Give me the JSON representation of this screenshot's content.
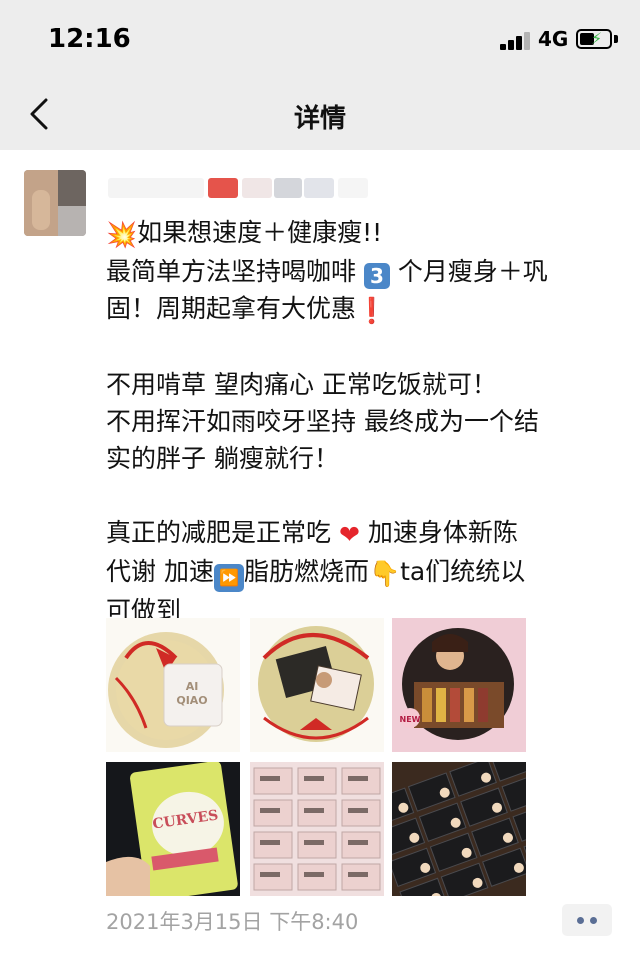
{
  "status_bar": {
    "time": "12:16",
    "network": "4G"
  },
  "nav": {
    "title": "详情"
  },
  "post": {
    "line1_text": "如果想速度＋健康瘦!!",
    "line2_text_a": "最简单方法坚持喝咖啡",
    "line2_text_b": "个月瘦身＋巩",
    "line3_text": "固！周期起拿有大优惠",
    "line4": "不用啃草 望肉痛心 正常吃饭就可！",
    "line5": "不用挥汗如雨咬牙坚持 最终成为一个结",
    "line6": "实的胖子 躺瘦就行！",
    "line7_a": "真正的减肥是正常吃",
    "line7_b": "加速身体新陈",
    "line8_a": "代谢 加速",
    "line8_b": "脂肪燃烧而",
    "line8_c": "ta们统统以",
    "line9": "可做到",
    "emoji_blast": "💥",
    "emoji_three": "3",
    "emoji_bang": "❗",
    "emoji_heart": "❤",
    "emoji_ff": "⏩",
    "emoji_hand": "👇",
    "timestamp": "2021年3月15日 下午8:40"
  },
  "photos": [
    {
      "label": "AI QIAO"
    },
    {
      "label": "package with ribbon"
    },
    {
      "label": "NEW"
    },
    {
      "label": "CURVES"
    },
    {
      "label": "stacked boxes"
    },
    {
      "label": "black boxes"
    }
  ],
  "photo_text": {
    "p1_brand": "AI\nQIAO",
    "p3_badge": "NEW",
    "p4_brand": "CURVES"
  },
  "colors": {
    "header_bg": "#ededed",
    "timestamp": "#a3a3a3",
    "more_dots": "#5a6e95",
    "battery_bolt": "#3cb94a"
  },
  "icons": {
    "back": "chevron-left-icon",
    "signal": "signal-icon",
    "battery": "battery-charging-icon",
    "more": "more-dots-icon"
  }
}
